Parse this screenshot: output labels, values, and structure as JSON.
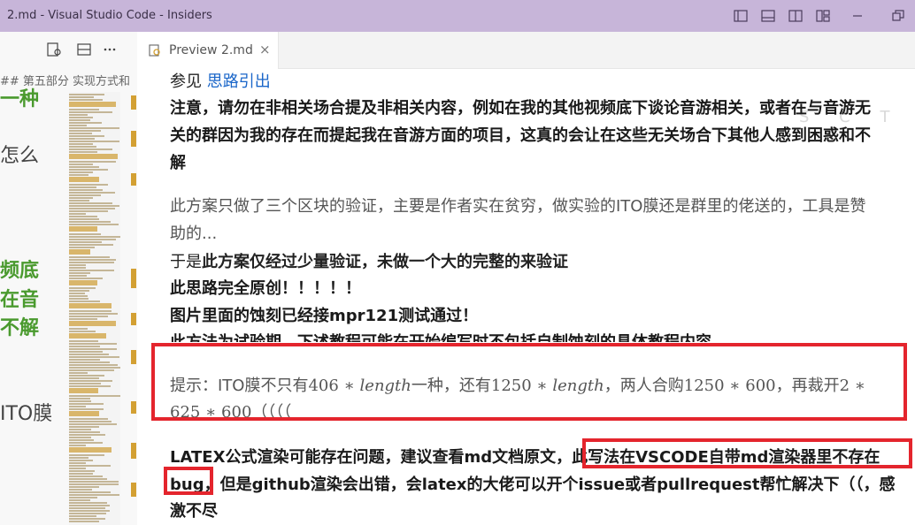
{
  "window": {
    "title": "2.md - Visual Studio Code - Insiders",
    "icons": [
      "layout-sidebar-left-icon",
      "layout-panel-icon",
      "layout-sidebar-right-icon",
      "customize-layout-icon",
      "minimize-icon",
      "restore-icon"
    ]
  },
  "left_editor": {
    "breadcrumb": "## 第五部分 实现方式和",
    "lines": [
      {
        "text": "一种",
        "style": "green"
      },
      {
        "text": "怎么",
        "style": "grey"
      },
      {
        "text": "频底",
        "style": "green"
      },
      {
        "text": "在音",
        "style": "green"
      },
      {
        "text": "不解",
        "style": "green"
      },
      {
        "text": "ITO膜",
        "style": "grey"
      }
    ]
  },
  "tab": {
    "label": "Preview 2.md",
    "close": "×"
  },
  "preview": {
    "see_also_prefix": "参见 ",
    "see_also_link": "思路引出",
    "notice_line1": "注意，请勿在非相关场合提及非相关内容，例如在我的其他视频底下谈论音游相关，或者在与音游无",
    "notice_line2": "关的群因为我的存在而提起我在音游方面的项目，这真的会让在这些无关场合下其他人感到困惑和不",
    "notice_line3": "解",
    "plan_line1": "此方案只做了三个区块的验证，主要是作者实在贫穷，做实验的ITO膜还是群里的佬送的，工具是赞",
    "plan_line2": "助的...",
    "verify_prefix": "于是",
    "verify_bold": "此方案仅经过少量验证，未做一个大的完整的来验证",
    "original": "此思路完全原创！！！！！",
    "tested": "图片里面的蚀刻已经接mpr121测试通过！",
    "experimental": "此方法为试验期，下述教程可能在开始编写时不包括自制蚀刻的具体教程内容",
    "tip_line1": {
      "prefix": "提示：ITO膜不只有",
      "m1_num": "406 ∗ ",
      "m1_var": "length",
      "mid": "一种，还有",
      "m2_num": "1250 ∗ ",
      "m2_var": "length",
      "mid2": "，两人合购",
      "m3": "1250 ∗ 600",
      "mid3": "，再裁开",
      "m4": "2 ∗"
    },
    "tip_line2": {
      "m5": "625 ∗ 600",
      "suffix": "（（（（"
    },
    "latex_line1_a": "LATEX公式渲染可能存在问题，建议查看md文档原文，",
    "latex_line1_b": "此写法在VSCODE自带md渲染器里不存在",
    "latex_line2_a": "bug",
    "latex_line2_b": "，但是github渲染会出错，会latex的大佬可以开个issue或者pullrequest帮忙解决下（（，感",
    "latex_line3": "激不尽",
    "faint_overlay": "S C T"
  },
  "colors": {
    "titlebar": "#c7b5d9",
    "highlight_box": "#e4252d",
    "link": "#1a66c9",
    "editor_heading": "#4a9a2e"
  }
}
